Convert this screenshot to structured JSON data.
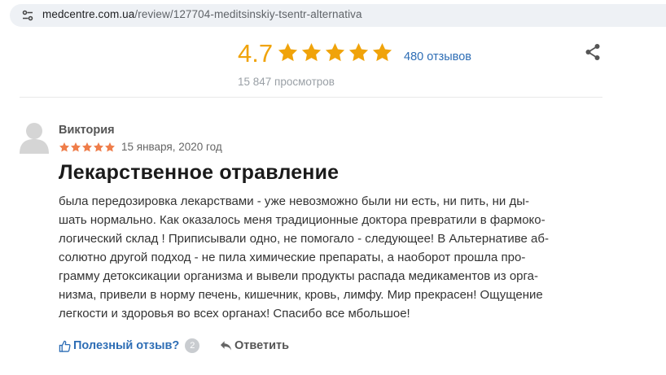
{
  "browser": {
    "url_domain": "medcentre.com.ua",
    "url_path": "/review/127704-meditsinskiy-tsentr-alternativa",
    "site_info_icon": "tune-icon"
  },
  "rating": {
    "value": "4.7",
    "stars": 5,
    "star_color": "#f0a30a",
    "reviews_count": "480 отзывов",
    "views": "15 847 просмотров",
    "share_icon": "share-icon"
  },
  "review": {
    "author": "Виктория",
    "stars": 5,
    "star_color": "#ef7d4a",
    "date": "15 января, 2020 год",
    "title": "Лекарственное отравление",
    "lines": [
      "была передозировка лекарствами - уже невозможно были ни есть, ни пить, ни ды-",
      "шать нормально. Как оказалось меня традиционные доктора превратили в фармоко-",
      "логический склад ! Приписывали одно, не помогало - следующее! В Альтернативе аб-",
      "солютно другой подход - не пила химические препараты, а наоборот прошла про-",
      "грамму детоксикации организма и вывели продукты распада медикаментов из орга-",
      "низма, привели в норму печень, кишечник, кровь, лимфу. Мир прекрасен! Ощущение",
      "легкости и здоровья во всех органах! Спасибо все мбольшое!"
    ],
    "helpful_label": "Полезный отзыв?",
    "helpful_count": "2",
    "reply_label": "Ответить"
  }
}
